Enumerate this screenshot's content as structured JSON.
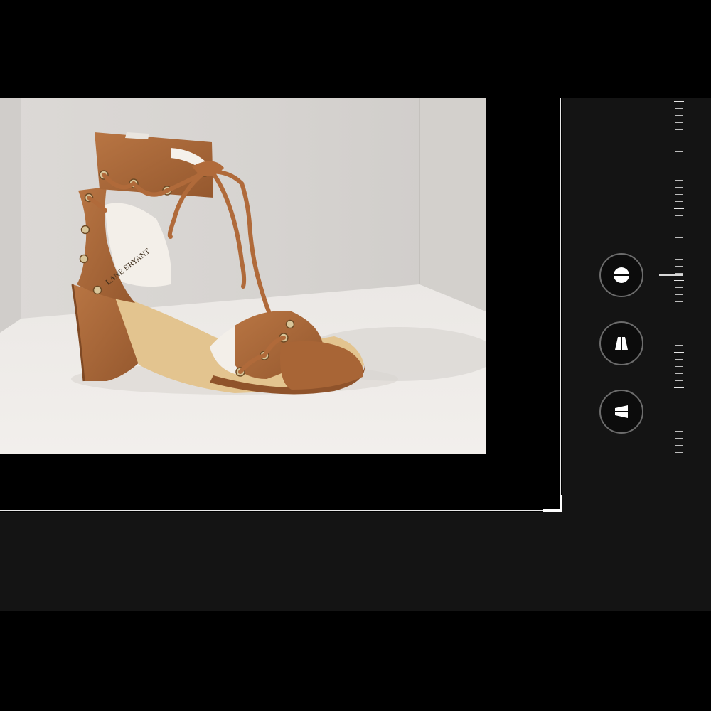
{
  "app": {
    "screen": "photo-crop-edit"
  },
  "photo": {
    "subject": "tan-suede-lace-up-block-heel-sandal",
    "insole_brand_text": "LANE BRYANT"
  },
  "tools": {
    "straighten": {
      "icon": "straighten-icon"
    },
    "vertical_perspective": {
      "icon": "vertical-perspective-icon"
    },
    "horizontal_perspective": {
      "icon": "horizontal-perspective-icon"
    }
  },
  "ruler": {
    "tick_count": 50,
    "position": 0.5
  },
  "colors": {
    "background": "#000000",
    "panel": "#141414",
    "crop_border": "#e8e8e8",
    "button_ring": "#6c6c6c",
    "suede": "#a8683a"
  }
}
